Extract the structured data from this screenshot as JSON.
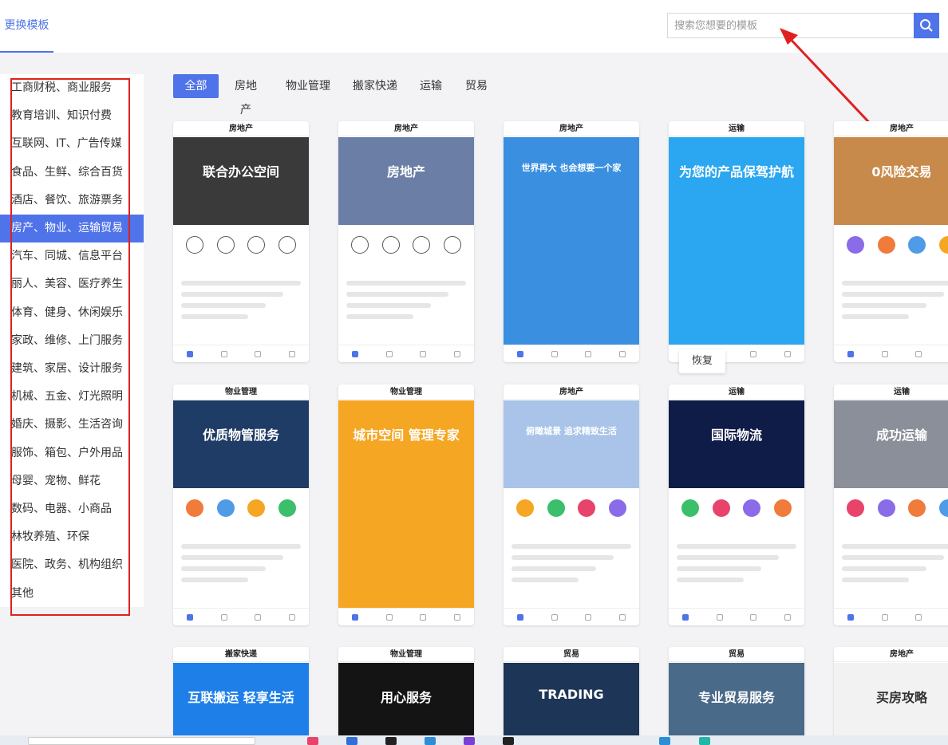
{
  "header": {
    "tab_label": "更换模板",
    "search_placeholder": "搜索您想要的模板"
  },
  "sidebar": {
    "items": [
      "工商财税、商业服务",
      "教育培训、知识付费",
      "互联网、IT、广告传媒",
      "食品、生鲜、综合百货",
      "酒店、餐饮、旅游票务",
      "房产、物业、运输贸易",
      "汽车、同城、信息平台",
      "丽人、美容、医疗养生",
      "体育、健身、休闲娱乐",
      "家政、维修、上门服务",
      "建筑、家居、设计服务",
      "机械、五金、灯光照明",
      "婚庆、摄影、生活咨询",
      "服饰、箱包、户外用品",
      "母婴、宠物、鲜花",
      "数码、电器、小商品",
      "林牧养殖、环保",
      "医院、政务、机构组织",
      "其他"
    ],
    "active_index": 5
  },
  "filters": [
    "全部",
    "房地产",
    "物业管理",
    "搬家快递",
    "运输",
    "贸易"
  ],
  "cards": [
    {
      "category": "房地产",
      "headline": "联合办公空间",
      "accent": "#222222",
      "banner": "#3a3a3a"
    },
    {
      "category": "房地产",
      "headline": "房地产",
      "accent": "#2b3f6b",
      "banner": "#6b7fa6"
    },
    {
      "category": "房地产",
      "headline": "世界再大 也会想要一个家",
      "accent": "#3a8fe0",
      "banner": "#3a8fe0"
    },
    {
      "category": "运输",
      "headline": "为您的产品保驾护航",
      "accent": "#2aa7f0",
      "banner": "#2aa7f0"
    },
    {
      "category": "房地产",
      "headline": "0风险交易",
      "accent": "#e55a1c",
      "banner": "#c88a4a"
    },
    {
      "category": "物业管理",
      "headline": "优质物管服务",
      "accent": "#1a3a6a",
      "banner": "#1f3c66"
    },
    {
      "category": "物业管理",
      "headline": "城市空间 管理专家",
      "accent": "#f59a1c",
      "banner": "#f5a623"
    },
    {
      "category": "房地产",
      "headline": "俯瞰城景 追求精致生活",
      "accent": "#2f6fd6",
      "banner": "#a9c4e8"
    },
    {
      "category": "运输",
      "headline": "国际物流",
      "accent": "#2f6fd6",
      "banner": "#0f1c48"
    },
    {
      "category": "运输",
      "headline": "成功运输",
      "accent": "#d9382c",
      "banner": "#8a8f99"
    },
    {
      "category": "搬家快递",
      "headline": "互联搬运 轻享生活",
      "accent": "#1e7fe8",
      "banner": "#1e7fe8"
    },
    {
      "category": "物业管理",
      "headline": "用心服务",
      "accent": "#222222",
      "banner": "#141414"
    },
    {
      "category": "贸易",
      "headline": "TRADING",
      "accent": "#1a3a6a",
      "banner": "#1d3556"
    },
    {
      "category": "贸易",
      "headline": "专业贸易服务",
      "accent": "#1a3a6a",
      "banner": "#4a6a8a"
    },
    {
      "category": "房地产",
      "headline": "买房攻略",
      "accent": "#2bb673",
      "banner": "#f2f2f2"
    }
  ],
  "tooltip": "恢复",
  "colors": {
    "accent": "#4f73e8",
    "highlight_box": "#e02020"
  }
}
